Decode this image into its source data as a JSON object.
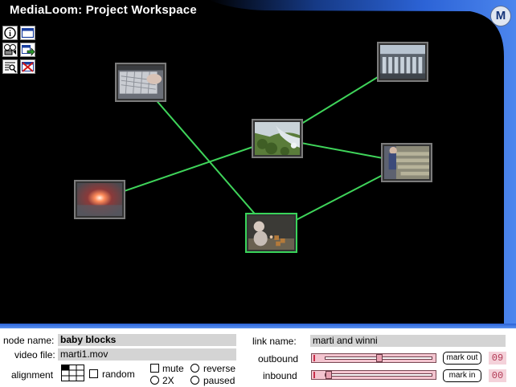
{
  "window": {
    "title": "MediaLoom: Project Workspace",
    "logo_letter": "M"
  },
  "toolbar": {
    "tools": [
      {
        "name": "info-icon"
      },
      {
        "name": "window-icon"
      },
      {
        "name": "film-reel-icon"
      },
      {
        "name": "export-window-icon"
      },
      {
        "name": "search-list-icon"
      },
      {
        "name": "delete-link-icon"
      }
    ]
  },
  "graph": {
    "link_color": "#3fd45a",
    "selected_border_color": "#39d45a",
    "nodes": [
      {
        "id": "keyboard",
        "scene": "keyboard",
        "selected": false
      },
      {
        "id": "building",
        "scene": "building",
        "selected": false
      },
      {
        "id": "grass",
        "scene": "grass",
        "selected": false
      },
      {
        "id": "sunset",
        "scene": "sunset",
        "selected": false
      },
      {
        "id": "stairs",
        "scene": "stairs",
        "selected": false
      },
      {
        "id": "baby-blocks",
        "scene": "baby",
        "selected": true
      }
    ],
    "links": [
      {
        "from": "keyboard",
        "to": "baby-blocks"
      },
      {
        "from": "building",
        "to": "grass"
      },
      {
        "from": "grass",
        "to": "sunset"
      },
      {
        "from": "grass",
        "to": "stairs"
      },
      {
        "from": "stairs",
        "to": "baby-blocks"
      }
    ]
  },
  "properties": {
    "node_name_label": "node name:",
    "node_name": "baby blocks",
    "video_file_label": "video file:",
    "video_file": "marti1.mov",
    "alignment_label": "alignment",
    "random_label": "random",
    "random_checked": false,
    "mute_label": "mute",
    "mute_checked": false,
    "speed_2x_label": "2X",
    "speed_2x_selected": false,
    "reverse_label": "reverse",
    "reverse_selected": false,
    "paused_label": "paused",
    "paused_selected": false,
    "link_name_label": "link name:",
    "link_name": "marti and winni",
    "outbound_label": "outbound",
    "outbound_position": 0.5,
    "inbound_label": "inbound",
    "inbound_position": 0.01,
    "mark_out_label": "mark out",
    "mark_in_label": "mark in",
    "outbound_value": "09",
    "inbound_value": "00"
  },
  "colors": {
    "background": "#000000",
    "panel_bar": "#3b74e3",
    "counter_text": "#b23a55",
    "slider_fill": "#f3c4cf"
  }
}
